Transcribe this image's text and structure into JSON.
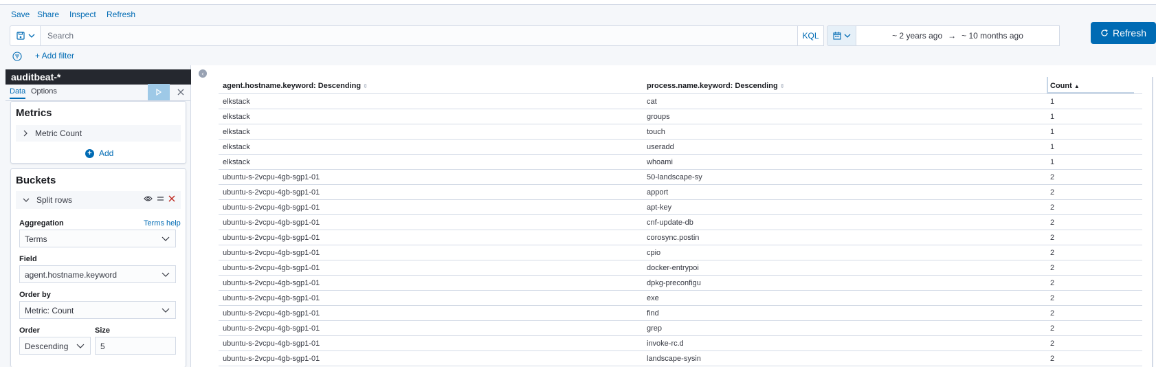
{
  "topnav": {
    "save": "Save",
    "share": "Share",
    "inspect": "Inspect",
    "refresh": "Refresh"
  },
  "query": {
    "placeholder": "Search",
    "language": "KQL",
    "time_start": "~ 2 years ago",
    "arrow": "→",
    "time_end": "~ 10 months ago",
    "refresh_label": "Refresh",
    "add_filter": "+ Add filter"
  },
  "sidebar": {
    "index_pattern": "auditbeat-*",
    "tabs": [
      "Data",
      "Options"
    ],
    "metrics": {
      "title": "Metrics",
      "item": "Metric Count",
      "add": "Add"
    },
    "buckets": {
      "title": "Buckets",
      "split_label": "Split rows",
      "aggregation_label": "Aggregation",
      "terms_help": "Terms help",
      "aggregation_value": "Terms",
      "field_label": "Field",
      "field_value": "agent.hostname.keyword",
      "orderby_label": "Order by",
      "orderby_value": "Metric: Count",
      "order_label": "Order",
      "order_value": "Descending",
      "size_label": "Size",
      "size_value": "5"
    }
  },
  "table": {
    "headers": [
      "agent.hostname.keyword: Descending",
      "process.name.keyword: Descending",
      "Count"
    ],
    "rows": [
      [
        "elkstack",
        "cat",
        "1"
      ],
      [
        "elkstack",
        "groups",
        "1"
      ],
      [
        "elkstack",
        "touch",
        "1"
      ],
      [
        "elkstack",
        "useradd",
        "1"
      ],
      [
        "elkstack",
        "whoami",
        "1"
      ],
      [
        "ubuntu-s-2vcpu-4gb-sgp1-01",
        "50-landscape-sy",
        "2"
      ],
      [
        "ubuntu-s-2vcpu-4gb-sgp1-01",
        "apport",
        "2"
      ],
      [
        "ubuntu-s-2vcpu-4gb-sgp1-01",
        "apt-key",
        "2"
      ],
      [
        "ubuntu-s-2vcpu-4gb-sgp1-01",
        "cnf-update-db",
        "2"
      ],
      [
        "ubuntu-s-2vcpu-4gb-sgp1-01",
        "corosync.postin",
        "2"
      ],
      [
        "ubuntu-s-2vcpu-4gb-sgp1-01",
        "cpio",
        "2"
      ],
      [
        "ubuntu-s-2vcpu-4gb-sgp1-01",
        "docker-entrypoi",
        "2"
      ],
      [
        "ubuntu-s-2vcpu-4gb-sgp1-01",
        "dpkg-preconfigu",
        "2"
      ],
      [
        "ubuntu-s-2vcpu-4gb-sgp1-01",
        "exe",
        "2"
      ],
      [
        "ubuntu-s-2vcpu-4gb-sgp1-01",
        "find",
        "2"
      ],
      [
        "ubuntu-s-2vcpu-4gb-sgp1-01",
        "grep",
        "2"
      ],
      [
        "ubuntu-s-2vcpu-4gb-sgp1-01",
        "invoke-rc.d",
        "2"
      ],
      [
        "ubuntu-s-2vcpu-4gb-sgp1-01",
        "landscape-sysin",
        "2"
      ]
    ]
  },
  "colors": {
    "accent": "#006bb4",
    "header_dark": "#25282f",
    "danger": "#bd271e"
  }
}
